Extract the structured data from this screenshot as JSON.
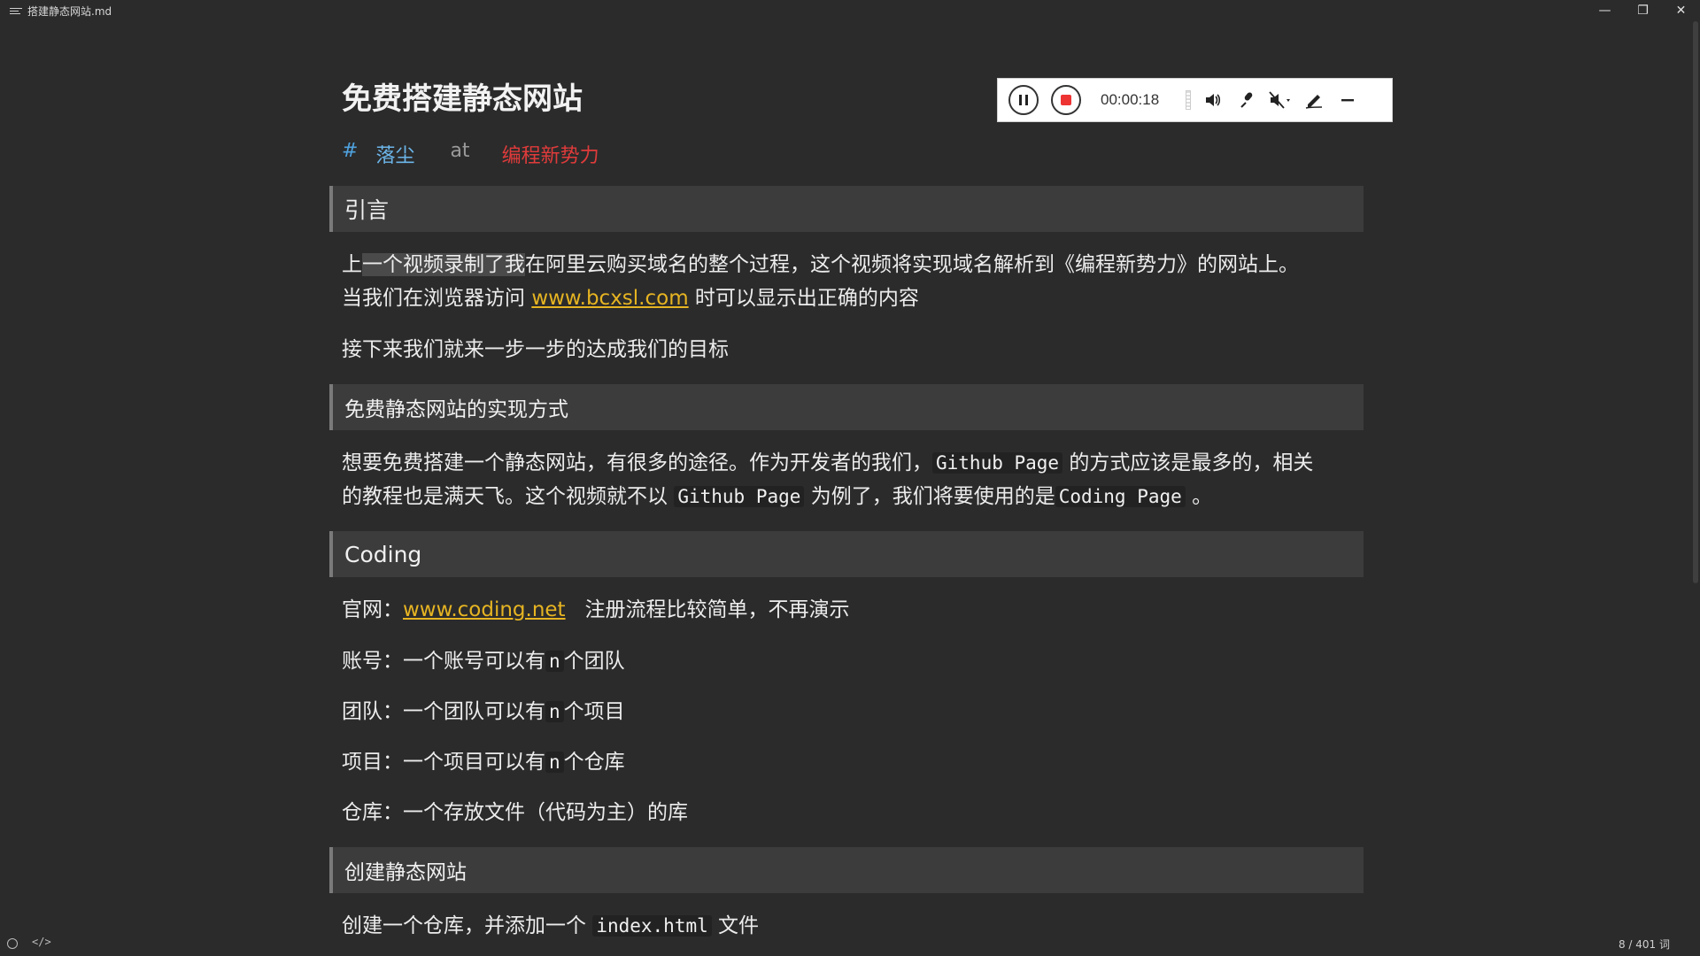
{
  "window": {
    "title": "搭建静态网站.md",
    "minimize_glyph": "—",
    "restore_glyph": "❐",
    "close_glyph": "✕"
  },
  "doc": {
    "title": "免费搭建静态网站",
    "byline": {
      "hash": "#",
      "author": "落尘",
      "at": "at",
      "org": "编程新势力"
    },
    "sections": {
      "intro_heading": "引言",
      "intro_p1_a": "上",
      "intro_p1_hl": "一个视频录制了我",
      "intro_p1_b": "在阿里云购买域名的整个过程，这个视频将实现域名解析到《编程新势力》的网站上。",
      "intro_p1_c": "当我们在浏览器访问 ",
      "intro_link": "www.bcxsl.com",
      "intro_p1_d": " 时可以显示出正确的内容",
      "intro_p2": "接下来我们就来一步一步的达成我们的目标",
      "impl_heading": "免费静态网站的实现方式",
      "impl_p1_a": "想要免费搭建一个静态网站，有很多的途径。作为开发者的我们，",
      "impl_code1": "Github Page",
      "impl_p1_b": " 的方式应该是最多的，相关",
      "impl_p1_c": "的教程也是满天飞。这个视频就不以 ",
      "impl_code2": "Github Page",
      "impl_p1_d": " 为例了，我们将要使用的是",
      "impl_code3": "Coding Page",
      "impl_p1_e": " 。",
      "coding_heading": "Coding",
      "site_label": "官网：",
      "site_link": "www.coding.net",
      "site_note": "   注册流程比较简单，不再演示",
      "account_a": "账号：一个账号可以有",
      "account_code": "n",
      "account_b": "个团队",
      "team_a": "团队：一个团队可以有",
      "team_code": "n",
      "team_b": "个项目",
      "project_a": "项目：一个项目可以有",
      "project_code": "n",
      "project_b": "个仓库",
      "repo": "仓库：一个存放文件（代码为主）的库",
      "create_heading": "创建静态网站",
      "create_a": "创建一个仓库，并添加一个 ",
      "create_code": "index.html",
      "create_b": " 文件"
    }
  },
  "recorder": {
    "timer": "00:00:18",
    "icons": [
      "pause-icon",
      "stop-icon",
      "volume-icon",
      "microphone-icon",
      "mute-dropdown-icon",
      "pen-icon",
      "minimize-icon"
    ]
  },
  "status": {
    "code_glyph": "</>",
    "word_count": "8 / 401 词"
  },
  "colors": {
    "link": "#e6b422",
    "author": "#6cb6ea",
    "org": "#e03b3b",
    "stop": "#ee3333"
  }
}
